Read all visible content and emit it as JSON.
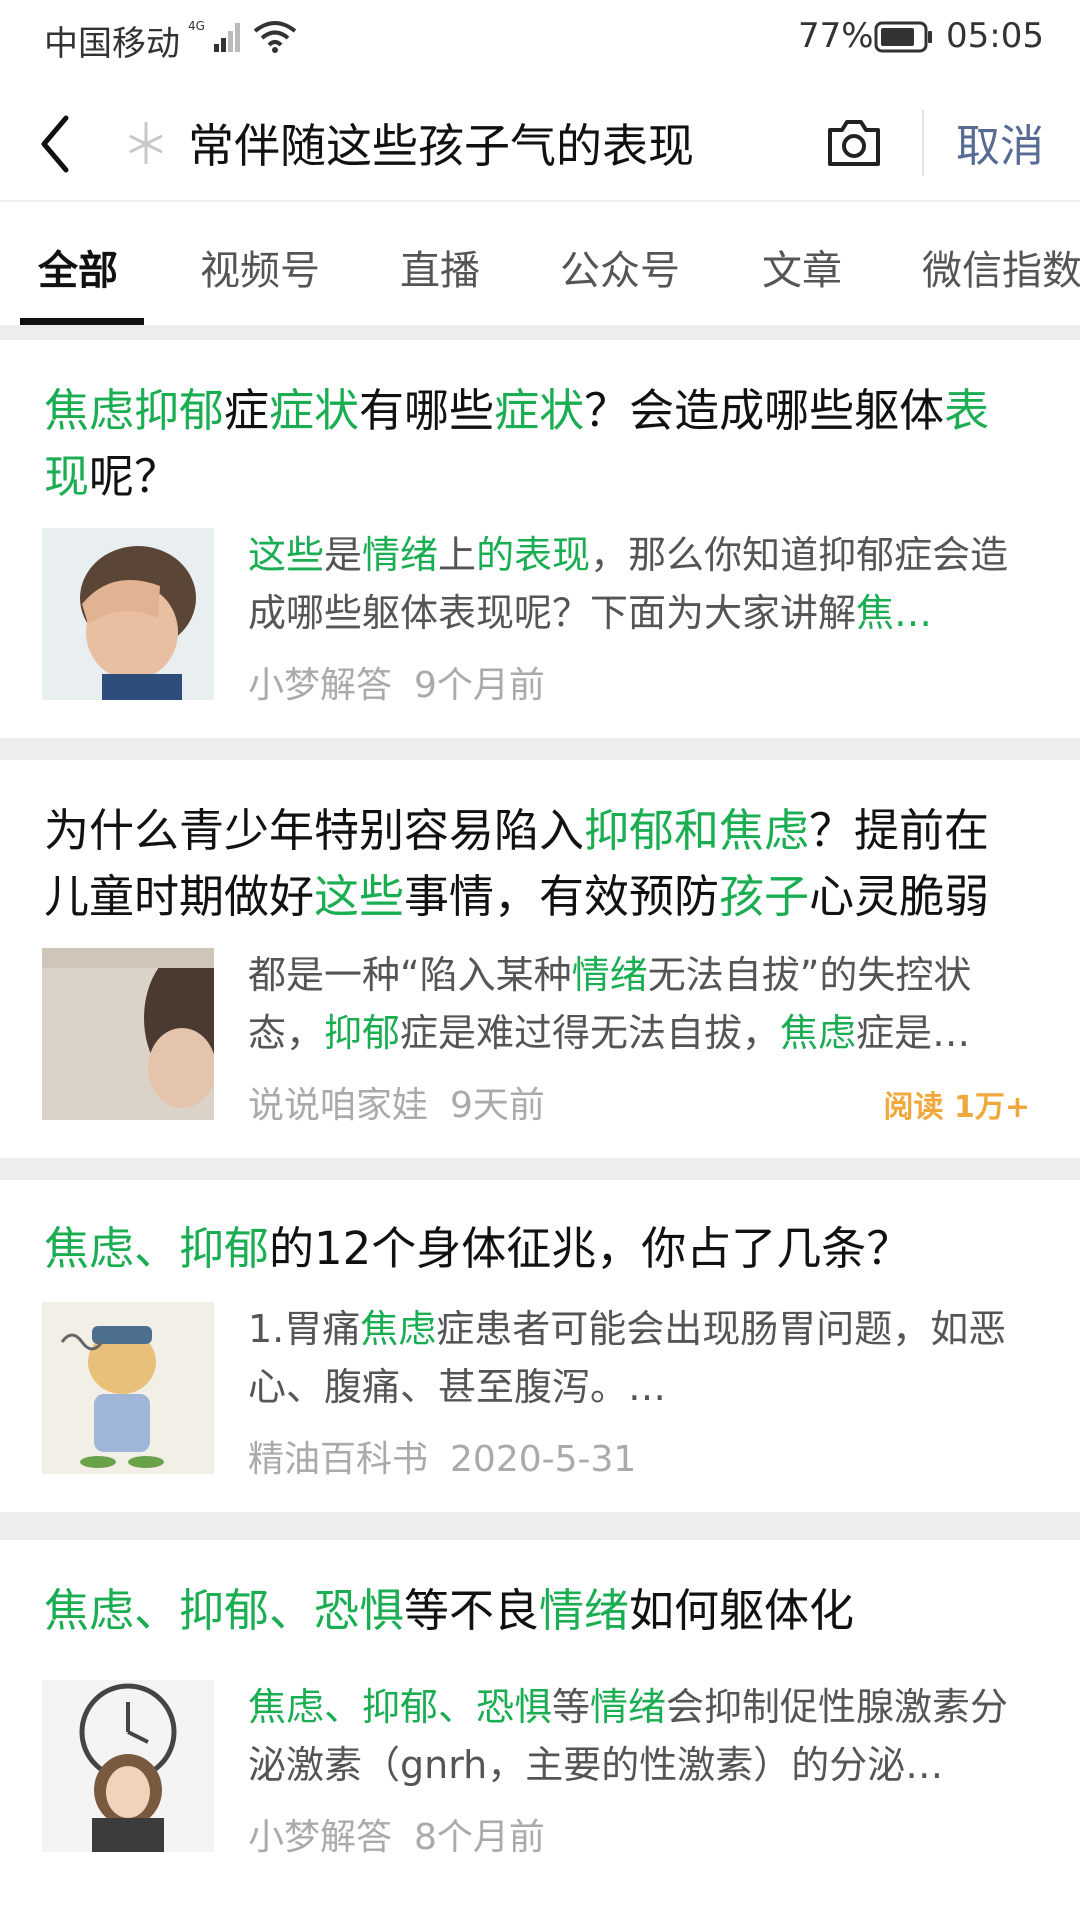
{
  "status_bar": {
    "carrier": "中国移动",
    "network": "4G",
    "battery_percent": "77%",
    "time": "05:05"
  },
  "search": {
    "query": "常伴随这些孩子气的表现",
    "cancel_label": "取消"
  },
  "tabs": [
    {
      "label": "全部",
      "active": true
    },
    {
      "label": "视频号"
    },
    {
      "label": "直播"
    },
    {
      "label": "公众号"
    },
    {
      "label": "文章"
    },
    {
      "label": "微信指数"
    }
  ],
  "colors": {
    "highlight": "#1aad52",
    "cancel": "#576b95",
    "reads": "#f0a83c"
  },
  "results": [
    {
      "title": [
        {
          "t": "焦虑抑郁",
          "hl": true
        },
        {
          "t": "症"
        },
        {
          "t": "症状",
          "hl": true
        },
        {
          "t": "有哪些"
        },
        {
          "t": "症状",
          "hl": true
        },
        {
          "t": "？会造成哪些躯体"
        },
        {
          "t": "表现",
          "hl": true
        },
        {
          "t": "呢？"
        }
      ],
      "snippet": [
        {
          "t": "这些",
          "hl": true
        },
        {
          "t": "是"
        },
        {
          "t": "情绪",
          "hl": true
        },
        {
          "t": "上"
        },
        {
          "t": "的表现",
          "hl": true
        },
        {
          "t": "，那么你知道抑郁症会造成哪些躯体表现呢？下面为大家讲解"
        },
        {
          "t": "焦…",
          "hl": true
        }
      ],
      "author": "小梦解答",
      "time": "9个月前",
      "thumbnail": "man-holding-head"
    },
    {
      "title": [
        {
          "t": "为什么青少年特别容易陷入"
        },
        {
          "t": "抑郁和焦虑",
          "hl": true
        },
        {
          "t": "？提前在儿童时期做好"
        },
        {
          "t": "这些",
          "hl": true
        },
        {
          "t": "事情，有效预防"
        },
        {
          "t": "孩子",
          "hl": true
        },
        {
          "t": "心灵脆弱"
        }
      ],
      "snippet": [
        {
          "t": "都是一种“陷入某种"
        },
        {
          "t": "情绪",
          "hl": true
        },
        {
          "t": "无法自拔”的失控状态，"
        },
        {
          "t": "抑郁",
          "hl": true
        },
        {
          "t": "症是难过得无法自拔，"
        },
        {
          "t": "焦虑",
          "hl": true
        },
        {
          "t": "症是…"
        }
      ],
      "author": "说说咱家娃",
      "time": "9天前",
      "reads": "阅读 1万+",
      "thumbnail": "sad-child"
    },
    {
      "title": [
        {
          "t": "焦虑、抑郁",
          "hl": true
        },
        {
          "t": "的12个身体征兆，你占了几条？"
        }
      ],
      "snippet": [
        {
          "t": "1.胃痛"
        },
        {
          "t": "焦虑",
          "hl": true
        },
        {
          "t": "症患者可能会出现肠胃问题，如恶心、腹痛、甚至腹泻。…"
        }
      ],
      "author": "精油百科书",
      "time": "2020-5-31",
      "thumbnail": "cartoon-stressed-man"
    },
    {
      "title": [
        {
          "t": "焦虑、抑郁、恐惧",
          "hl": true
        },
        {
          "t": "等不良"
        },
        {
          "t": "情绪",
          "hl": true
        },
        {
          "t": "如何躯体化"
        }
      ],
      "snippet": [
        {
          "t": "焦虑、抑郁、恐惧",
          "hl": true
        },
        {
          "t": "等"
        },
        {
          "t": "情绪",
          "hl": true
        },
        {
          "t": "会抑制促性腺激素分泌激素（gnrh，主要的性激素）的分泌…"
        }
      ],
      "author": "小梦解答",
      "time": "8个月前",
      "thumbnail": "woman-with-clock"
    }
  ]
}
